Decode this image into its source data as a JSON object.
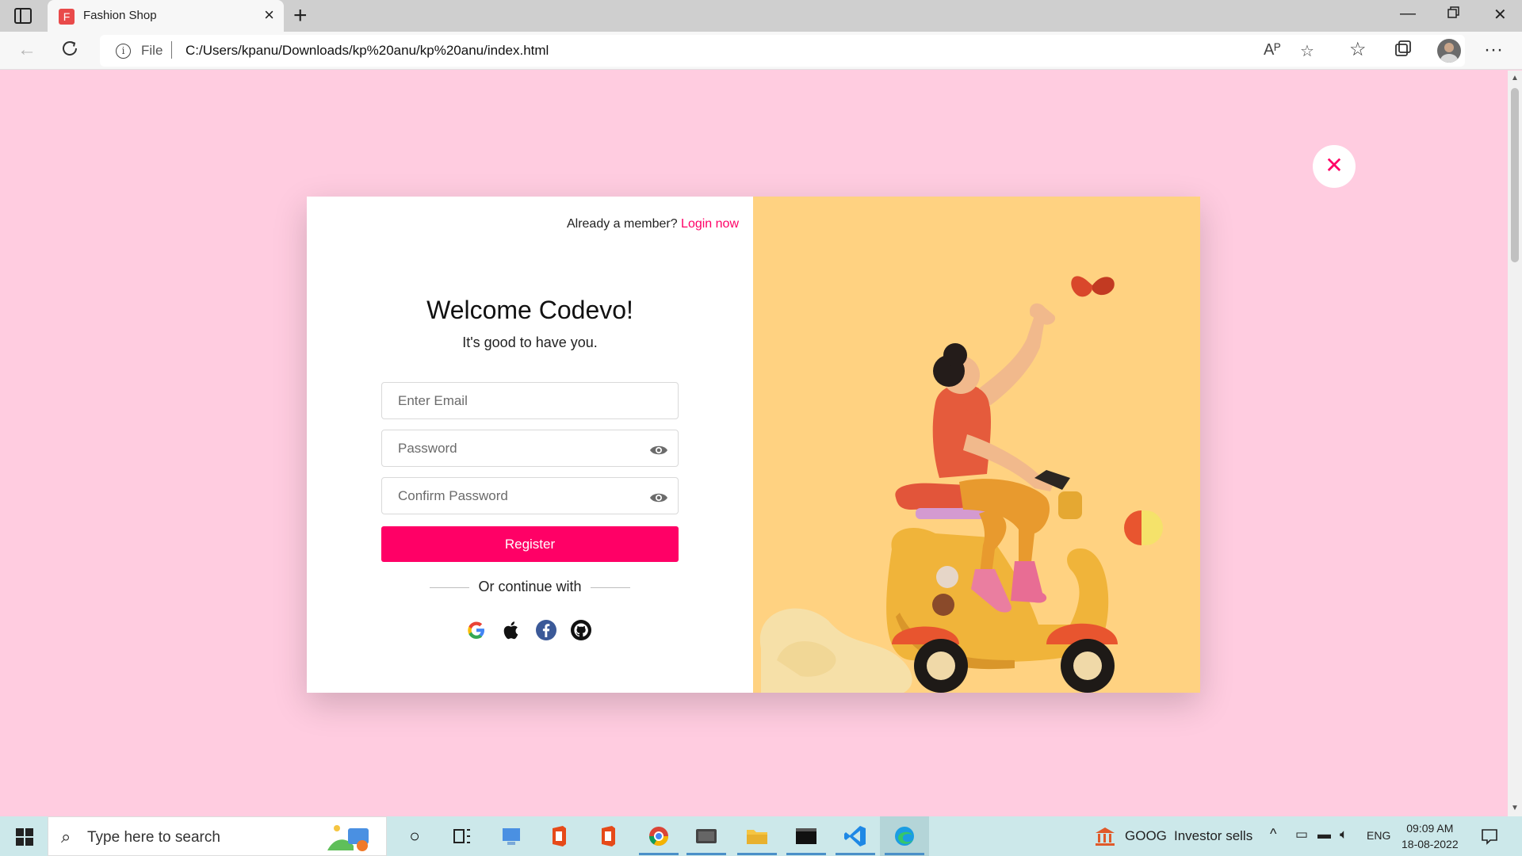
{
  "browser": {
    "tab_title": "Fashion Shop",
    "tab_favicon_letter": "F",
    "address_scheme_label": "File",
    "url": "C:/Users/kpanu/Downloads/kp%20anu/kp%20anu/index.html",
    "read_aloud_label": "Aᴾ"
  },
  "modal": {
    "member_prompt": "Already a member?",
    "login_link": "Login now",
    "welcome_title": "Welcome Codevo!",
    "subtitle": "It's good to have you.",
    "email_placeholder": "Enter Email",
    "password_placeholder": "Password",
    "confirm_placeholder": "Confirm Password",
    "register_label": "Register",
    "continue_label": "Or continue with",
    "close_glyph": "✕",
    "colors": {
      "accent": "#ff0066",
      "page_bg": "#ffcce0",
      "art_bg": "#ffd281"
    },
    "social_icons": [
      "google-icon",
      "apple-icon",
      "facebook-icon",
      "github-icon"
    ]
  },
  "taskbar": {
    "search_placeholder": "Type here to search",
    "news_ticker": "GOOG",
    "news_text": "Investor sells",
    "language": "ENG",
    "time": "09:09 AM",
    "date": "18-08-2022"
  }
}
